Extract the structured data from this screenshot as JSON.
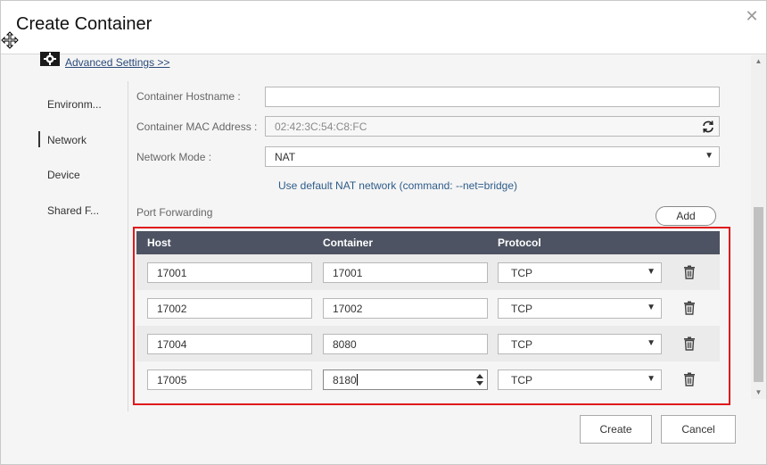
{
  "window": {
    "title": "Create Container",
    "close_icon": "close-icon",
    "move_icon": "move-cursor-icon"
  },
  "advanced": {
    "icon": "gear-icon",
    "link_label": "Advanced Settings >>"
  },
  "sidebar": {
    "items": [
      {
        "label": "Environm..."
      },
      {
        "label": "Network",
        "active": true
      },
      {
        "label": "Device"
      },
      {
        "label": "Shared F..."
      }
    ]
  },
  "network": {
    "hostname_label": "Container Hostname :",
    "hostname_value": "",
    "mac_label": "Container MAC Address :",
    "mac_value": "02:42:3C:54:C8:FC",
    "mode_label": "Network Mode :",
    "mode_value": "NAT",
    "nat_hint": "Use default NAT network (command: --net=bridge)"
  },
  "port_forwarding": {
    "label": "Port Forwarding",
    "add_label": "Add",
    "columns": {
      "host": "Host",
      "container": "Container",
      "protocol": "Protocol"
    },
    "rows": [
      {
        "host": "17001",
        "container": "17001",
        "protocol": "TCP"
      },
      {
        "host": "17002",
        "container": "17002",
        "protocol": "TCP"
      },
      {
        "host": "17004",
        "container": "8080",
        "protocol": "TCP"
      },
      {
        "host": "17005",
        "container": "8180",
        "protocol": "TCP"
      }
    ]
  },
  "footer": {
    "create_label": "Create",
    "cancel_label": "Cancel"
  },
  "colors": {
    "table_header": "#4d5362",
    "highlight_border": "#e0191b",
    "link": "#2b4a7a"
  }
}
